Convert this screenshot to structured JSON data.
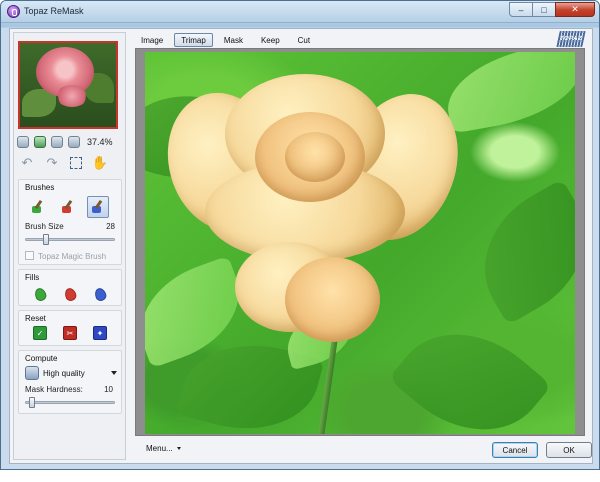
{
  "window": {
    "title": "Topaz ReMask"
  },
  "titlebar": {
    "minimize": "–",
    "maximize": "□",
    "close": "✕"
  },
  "zoom": {
    "value": "37.4%"
  },
  "tabs": [
    {
      "label": "Image"
    },
    {
      "label": "Trimap",
      "active": true
    },
    {
      "label": "Mask"
    },
    {
      "label": "Keep"
    },
    {
      "label": "Cut"
    }
  ],
  "logo": {
    "text": "TOPAZ"
  },
  "brushes": {
    "title": "Brushes",
    "size_label": "Brush Size",
    "size_value": "28",
    "magic_brush_label": "Topaz Magic Brush",
    "magic_brush_checked": false,
    "brush_colors": [
      "#3aa83a",
      "#d23b2f",
      "#3b5fd1"
    ]
  },
  "fills": {
    "title": "Fills",
    "colors": [
      "#3aa83a",
      "#d23b2f",
      "#3b5fd1"
    ]
  },
  "reset": {
    "title": "Reset",
    "colors": [
      "#2f9a3a",
      "#c02d25",
      "#2f47c4"
    ]
  },
  "compute": {
    "title": "Compute",
    "quality": "High quality",
    "hardness_label": "Mask Hardness:",
    "hardness_value": "10"
  },
  "bottom": {
    "menu_label": "Menu...",
    "cancel_label": "Cancel",
    "ok_label": "OK"
  }
}
